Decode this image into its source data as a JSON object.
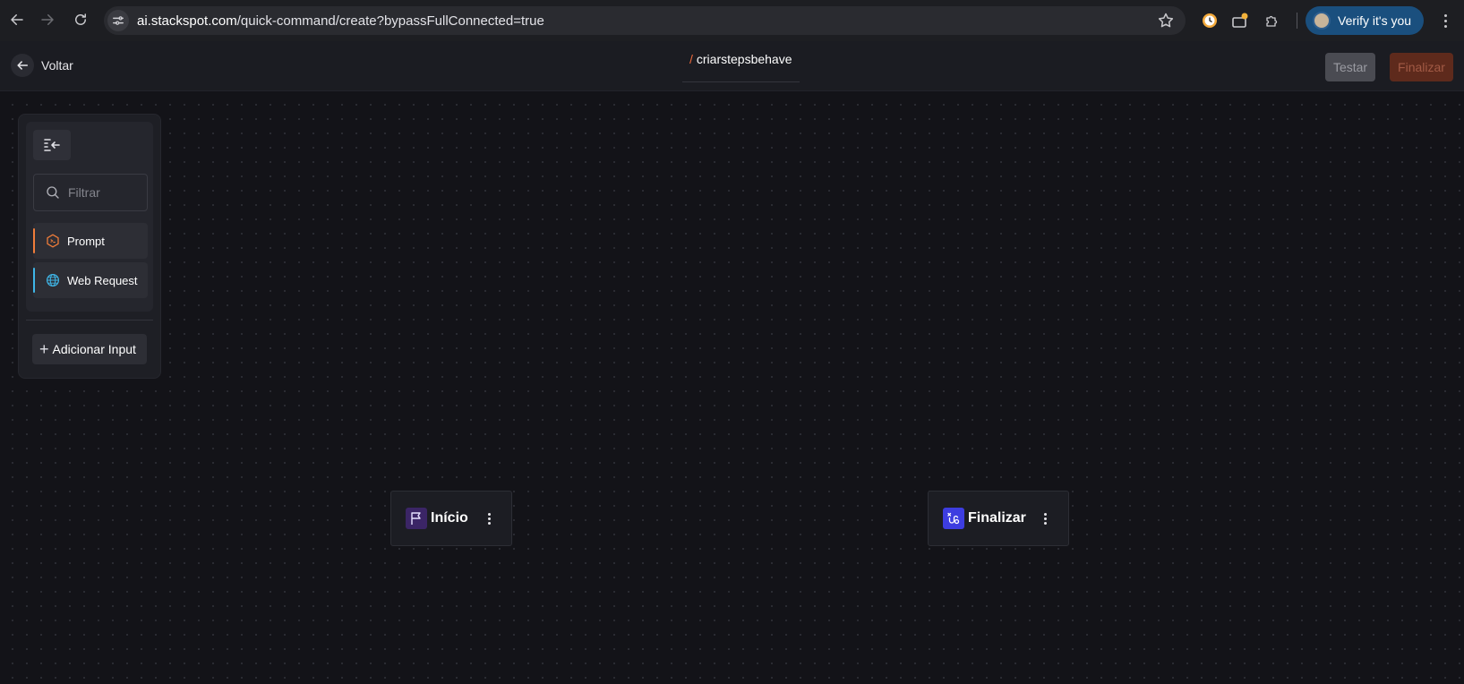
{
  "browser": {
    "url_host": "ai.stackspot.com",
    "url_path": "/quick-command/create?bypassFullConnected=true",
    "profile_button": "Verify it's you"
  },
  "header": {
    "back_label": "Voltar",
    "title_slash": "/",
    "title": "criarstepsbehave",
    "test_button": "Testar",
    "finalize_button": "Finalizar"
  },
  "panel": {
    "filter_placeholder": "Filtrar",
    "items": [
      {
        "label": "Prompt",
        "icon": "prompt-hexagon-icon",
        "accent": "#f07d3a"
      },
      {
        "label": "Web Request",
        "icon": "globe-icon",
        "accent": "#3fb6e8"
      }
    ],
    "add_input_label": "Adicionar Input"
  },
  "nodes": [
    {
      "label": "Início",
      "icon": "flag-icon",
      "icon_bg": "#3b2566"
    },
    {
      "label": "Finalizar",
      "icon": "route-icon",
      "icon_bg": "#3d3de0"
    }
  ],
  "colors": {
    "canvas": "#131318",
    "header": "#1b1c22",
    "accent_orange": "#f06a3c"
  }
}
